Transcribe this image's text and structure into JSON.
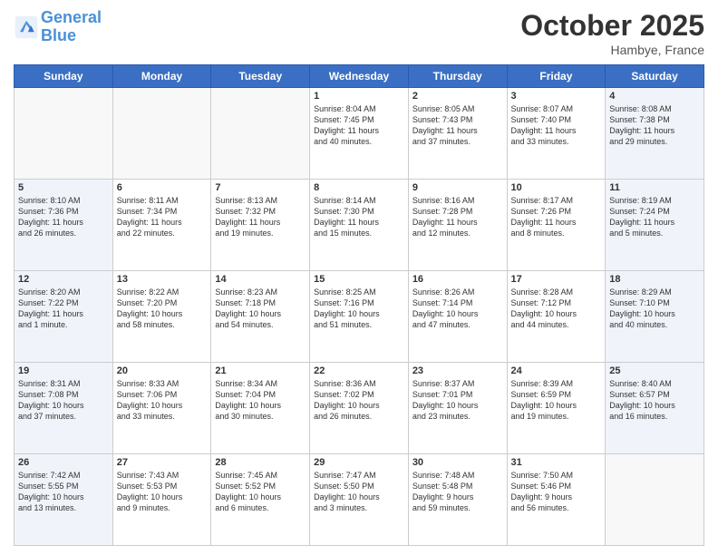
{
  "header": {
    "logo_line1": "General",
    "logo_line2": "Blue",
    "month": "October 2025",
    "location": "Hambye, France"
  },
  "days_of_week": [
    "Sunday",
    "Monday",
    "Tuesday",
    "Wednesday",
    "Thursday",
    "Friday",
    "Saturday"
  ],
  "weeks": [
    [
      {
        "day": "",
        "content": ""
      },
      {
        "day": "",
        "content": ""
      },
      {
        "day": "",
        "content": ""
      },
      {
        "day": "1",
        "content": "Sunrise: 8:04 AM\nSunset: 7:45 PM\nDaylight: 11 hours\nand 40 minutes."
      },
      {
        "day": "2",
        "content": "Sunrise: 8:05 AM\nSunset: 7:43 PM\nDaylight: 11 hours\nand 37 minutes."
      },
      {
        "day": "3",
        "content": "Sunrise: 8:07 AM\nSunset: 7:40 PM\nDaylight: 11 hours\nand 33 minutes."
      },
      {
        "day": "4",
        "content": "Sunrise: 8:08 AM\nSunset: 7:38 PM\nDaylight: 11 hours\nand 29 minutes."
      }
    ],
    [
      {
        "day": "5",
        "content": "Sunrise: 8:10 AM\nSunset: 7:36 PM\nDaylight: 11 hours\nand 26 minutes."
      },
      {
        "day": "6",
        "content": "Sunrise: 8:11 AM\nSunset: 7:34 PM\nDaylight: 11 hours\nand 22 minutes."
      },
      {
        "day": "7",
        "content": "Sunrise: 8:13 AM\nSunset: 7:32 PM\nDaylight: 11 hours\nand 19 minutes."
      },
      {
        "day": "8",
        "content": "Sunrise: 8:14 AM\nSunset: 7:30 PM\nDaylight: 11 hours\nand 15 minutes."
      },
      {
        "day": "9",
        "content": "Sunrise: 8:16 AM\nSunset: 7:28 PM\nDaylight: 11 hours\nand 12 minutes."
      },
      {
        "day": "10",
        "content": "Sunrise: 8:17 AM\nSunset: 7:26 PM\nDaylight: 11 hours\nand 8 minutes."
      },
      {
        "day": "11",
        "content": "Sunrise: 8:19 AM\nSunset: 7:24 PM\nDaylight: 11 hours\nand 5 minutes."
      }
    ],
    [
      {
        "day": "12",
        "content": "Sunrise: 8:20 AM\nSunset: 7:22 PM\nDaylight: 11 hours\nand 1 minute."
      },
      {
        "day": "13",
        "content": "Sunrise: 8:22 AM\nSunset: 7:20 PM\nDaylight: 10 hours\nand 58 minutes."
      },
      {
        "day": "14",
        "content": "Sunrise: 8:23 AM\nSunset: 7:18 PM\nDaylight: 10 hours\nand 54 minutes."
      },
      {
        "day": "15",
        "content": "Sunrise: 8:25 AM\nSunset: 7:16 PM\nDaylight: 10 hours\nand 51 minutes."
      },
      {
        "day": "16",
        "content": "Sunrise: 8:26 AM\nSunset: 7:14 PM\nDaylight: 10 hours\nand 47 minutes."
      },
      {
        "day": "17",
        "content": "Sunrise: 8:28 AM\nSunset: 7:12 PM\nDaylight: 10 hours\nand 44 minutes."
      },
      {
        "day": "18",
        "content": "Sunrise: 8:29 AM\nSunset: 7:10 PM\nDaylight: 10 hours\nand 40 minutes."
      }
    ],
    [
      {
        "day": "19",
        "content": "Sunrise: 8:31 AM\nSunset: 7:08 PM\nDaylight: 10 hours\nand 37 minutes."
      },
      {
        "day": "20",
        "content": "Sunrise: 8:33 AM\nSunset: 7:06 PM\nDaylight: 10 hours\nand 33 minutes."
      },
      {
        "day": "21",
        "content": "Sunrise: 8:34 AM\nSunset: 7:04 PM\nDaylight: 10 hours\nand 30 minutes."
      },
      {
        "day": "22",
        "content": "Sunrise: 8:36 AM\nSunset: 7:02 PM\nDaylight: 10 hours\nand 26 minutes."
      },
      {
        "day": "23",
        "content": "Sunrise: 8:37 AM\nSunset: 7:01 PM\nDaylight: 10 hours\nand 23 minutes."
      },
      {
        "day": "24",
        "content": "Sunrise: 8:39 AM\nSunset: 6:59 PM\nDaylight: 10 hours\nand 19 minutes."
      },
      {
        "day": "25",
        "content": "Sunrise: 8:40 AM\nSunset: 6:57 PM\nDaylight: 10 hours\nand 16 minutes."
      }
    ],
    [
      {
        "day": "26",
        "content": "Sunrise: 7:42 AM\nSunset: 5:55 PM\nDaylight: 10 hours\nand 13 minutes."
      },
      {
        "day": "27",
        "content": "Sunrise: 7:43 AM\nSunset: 5:53 PM\nDaylight: 10 hours\nand 9 minutes."
      },
      {
        "day": "28",
        "content": "Sunrise: 7:45 AM\nSunset: 5:52 PM\nDaylight: 10 hours\nand 6 minutes."
      },
      {
        "day": "29",
        "content": "Sunrise: 7:47 AM\nSunset: 5:50 PM\nDaylight: 10 hours\nand 3 minutes."
      },
      {
        "day": "30",
        "content": "Sunrise: 7:48 AM\nSunset: 5:48 PM\nDaylight: 9 hours\nand 59 minutes."
      },
      {
        "day": "31",
        "content": "Sunrise: 7:50 AM\nSunset: 5:46 PM\nDaylight: 9 hours\nand 56 minutes."
      },
      {
        "day": "",
        "content": ""
      }
    ]
  ]
}
